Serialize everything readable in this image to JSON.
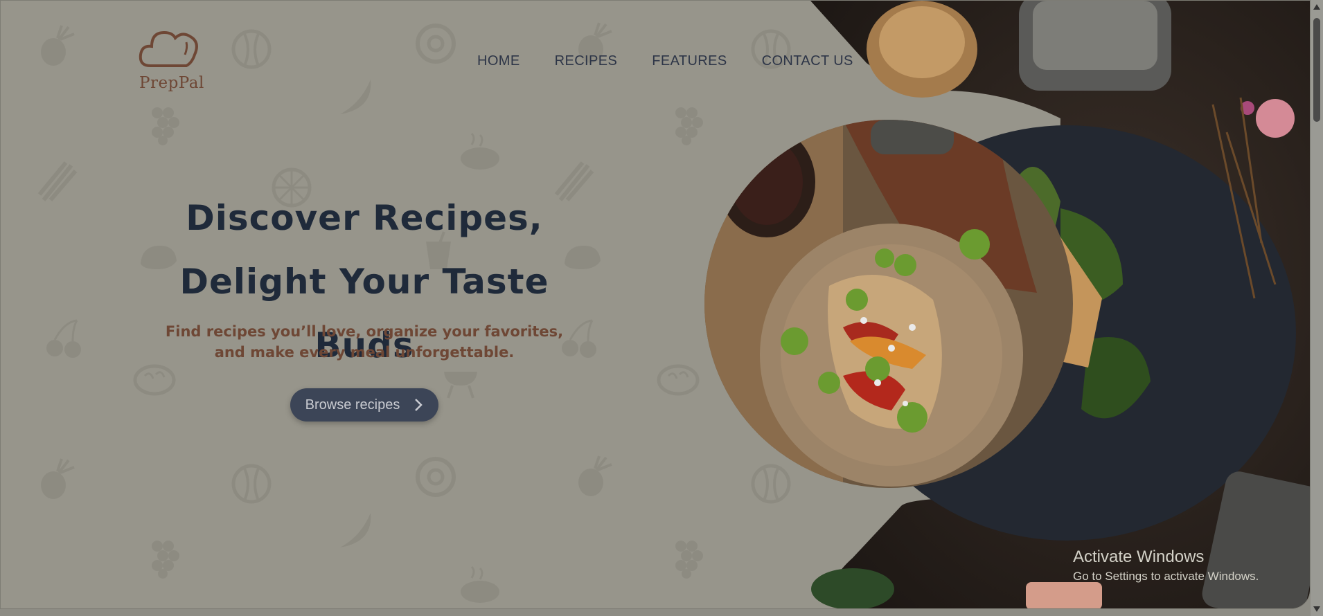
{
  "brand": {
    "name": "PrepPal",
    "logo_icon": "chef-hat-icon",
    "color": "#6e4735"
  },
  "nav": {
    "items": [
      {
        "label": "HOME"
      },
      {
        "label": "RECIPES"
      },
      {
        "label": "FEATURES"
      },
      {
        "label": "CONTACT US"
      }
    ]
  },
  "hero": {
    "title_line1": "Discover Recipes,",
    "title_line2": "Delight Your Taste Buds",
    "subtitle_line1": "Find recipes you’ll love, organize your favorites,",
    "subtitle_line2": "and make every meal unforgettable.",
    "cta_label": "Browse recipes",
    "cta_icon": "chevron-right-icon"
  },
  "watermark": {
    "title": "Activate Windows",
    "subtitle": "Go to Settings to activate Windows."
  },
  "colors": {
    "page_bg": "#97958b",
    "title": "#1f2a3a",
    "nav": "#2d3547",
    "button": "#3c4557"
  }
}
